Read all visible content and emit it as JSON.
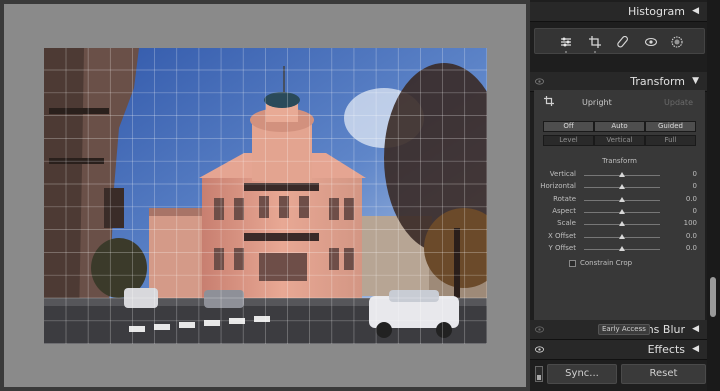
{
  "panels": {
    "histogram": {
      "title": "Histogram"
    },
    "transform": {
      "title": "Transform",
      "upright_label": "Upright",
      "update_label": "Update",
      "upright_buttons": [
        {
          "label": "Off",
          "selected": true
        },
        {
          "label": "Auto",
          "selected": true
        },
        {
          "label": "Guided",
          "selected": true
        },
        {
          "label": "Level",
          "selected": false
        },
        {
          "label": "Vertical",
          "selected": false
        },
        {
          "label": "Full",
          "selected": false
        }
      ],
      "subheading": "Transform",
      "sliders": [
        {
          "label": "Vertical",
          "value": "0",
          "position": 0.5
        },
        {
          "label": "Horizontal",
          "value": "0",
          "position": 0.5
        },
        {
          "label": "Rotate",
          "value": "0.0",
          "position": 0.5
        },
        {
          "label": "Aspect",
          "value": "0",
          "position": 0.5
        },
        {
          "label": "Scale",
          "value": "100",
          "position": 0.5
        },
        {
          "label": "X Offset",
          "value": "0.0",
          "position": 0.5
        },
        {
          "label": "Y Offset",
          "value": "0.0",
          "position": 0.5
        }
      ],
      "constrain_crop_label": "Constrain Crop",
      "constrain_crop_checked": false
    },
    "lens_blur": {
      "title": "Lens Blur",
      "badge": "Early Access"
    },
    "effects": {
      "title": "Effects"
    }
  },
  "tools": [
    {
      "icon": "sliders-icon",
      "name": "tool-edit"
    },
    {
      "icon": "crop-icon",
      "name": "tool-crop"
    },
    {
      "icon": "healing-icon",
      "name": "tool-healing"
    },
    {
      "icon": "red-eye-icon",
      "name": "tool-red-eye"
    },
    {
      "icon": "masking-icon",
      "name": "tool-masking"
    }
  ],
  "buttons": {
    "sync": "Sync...",
    "reset": "Reset"
  },
  "colors": {
    "panel_bg": "#383838",
    "header_bg": "#282828",
    "canvas_bg": "#8a8a8a",
    "text": "#e0e0e0"
  }
}
